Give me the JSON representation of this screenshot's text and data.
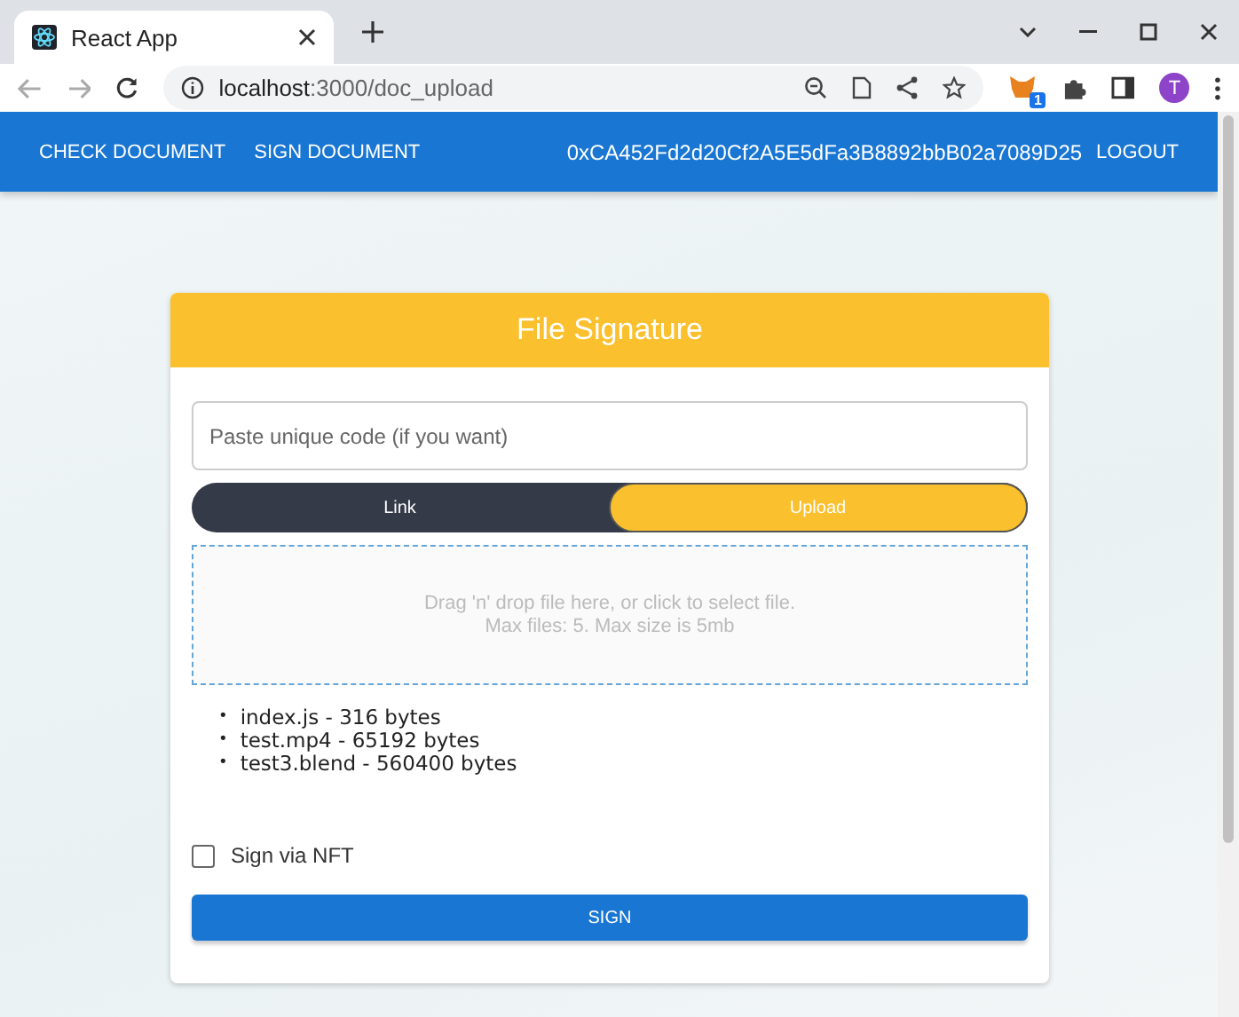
{
  "browser": {
    "tab_title": "React App",
    "url_host": "localhost",
    "url_path": ":3000/doc_upload",
    "extension_badge": "1",
    "profile_initial": "T"
  },
  "navbar": {
    "links": [
      "CHECK DOCUMENT",
      "SIGN DOCUMENT"
    ],
    "account": "0xCA452Fd2d20Cf2A5E5dFa3B8892bbB02a7089D25",
    "logout": "LOGOUT"
  },
  "card": {
    "title": "File Signature",
    "code_field": {
      "placeholder": "Paste unique code (if you want)"
    },
    "mode_toggle": [
      {
        "label": "Link",
        "selected": false
      },
      {
        "label": "Upload",
        "selected": true
      }
    ],
    "dropzone": {
      "lines": [
        "Drag 'n' drop file here, or click to select file.",
        "Max files: 5. Max size is 5mb"
      ]
    },
    "files": [
      {
        "marker": "•",
        "text": "index.js - 316 bytes"
      },
      {
        "marker": "•",
        "text": "test.mp4 - 65192 bytes"
      },
      {
        "marker": "•",
        "text": "test3.blend - 560400 bytes"
      }
    ],
    "nft_checkbox": {
      "label": "Sign via NFT",
      "checked": false
    },
    "sign_button": "SIGN"
  }
}
